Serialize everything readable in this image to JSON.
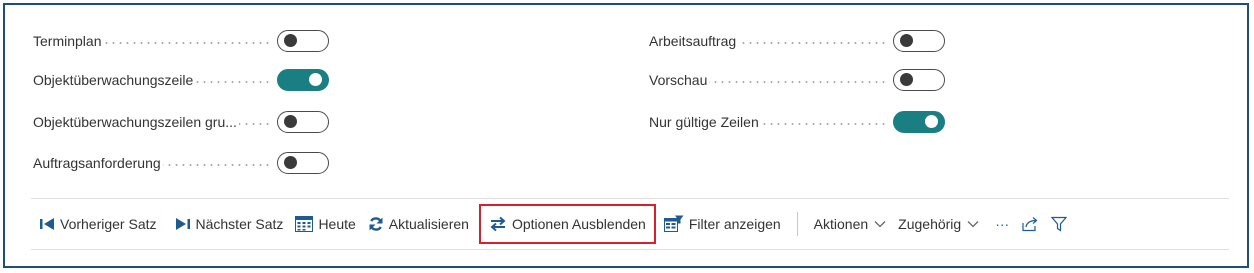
{
  "fields": {
    "left": [
      {
        "label": "Terminplan",
        "on": false
      },
      {
        "label": "Objektüberwachungszeile",
        "on": true
      },
      {
        "label": "Objektüberwachungszeilen gru...",
        "on": false
      },
      {
        "label": "Auftragsanforderung",
        "on": false
      }
    ],
    "right": [
      {
        "label": "Arbeitsauftrag",
        "on": false
      },
      {
        "label": "Vorschau",
        "on": false
      },
      {
        "label": "Nur gültige Zeilen",
        "on": true
      }
    ]
  },
  "toolbar": {
    "previous_label": "Vorheriger Satz",
    "next_label": "Nächster Satz",
    "today_label": "Heute",
    "refresh_label": "Aktualisieren",
    "hide_options_label": "Optionen Ausblenden",
    "show_filter_label": "Filter anzeigen",
    "actions_label": "Aktionen",
    "related_label": "Zugehörig",
    "more_label": "···"
  },
  "colors": {
    "accent": "#1a7f82",
    "frame": "#1e4e79",
    "highlight": "#d8202a",
    "icon_blue": "#1e5b8f"
  },
  "icons": {
    "previous": "previous-record-icon",
    "next": "next-record-icon",
    "today": "calendar-icon",
    "refresh": "refresh-icon",
    "hide_options": "swap-arrows-icon",
    "filter": "filter-pane-icon",
    "share": "share-icon",
    "funnel": "funnel-icon"
  }
}
